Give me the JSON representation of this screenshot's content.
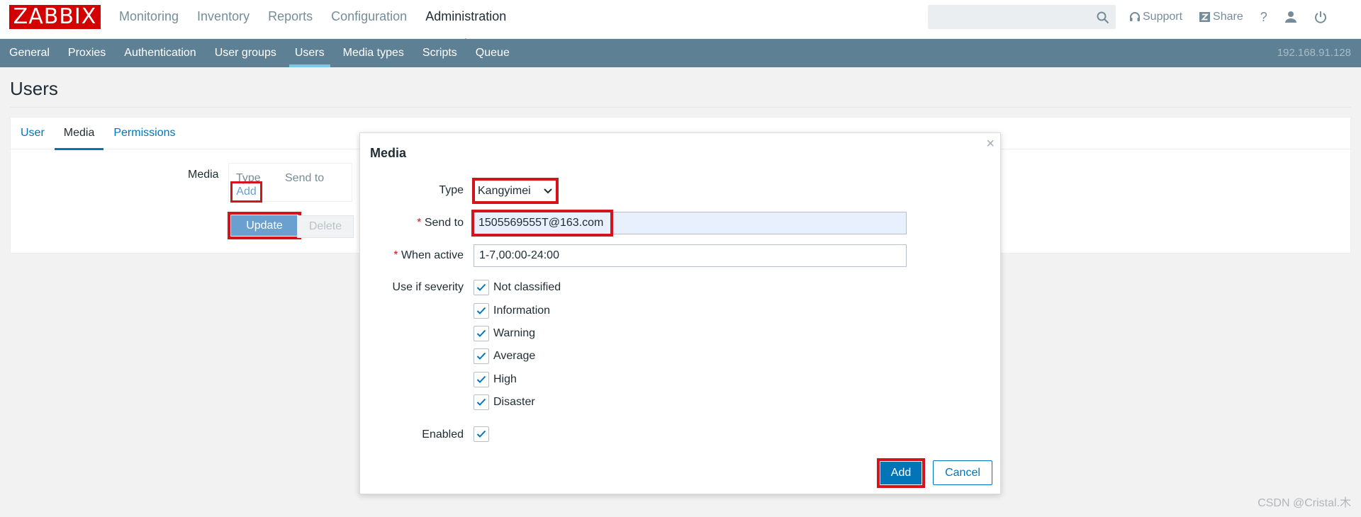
{
  "header": {
    "logo": "ZABBIX",
    "menu": [
      "Monitoring",
      "Inventory",
      "Reports",
      "Configuration",
      "Administration"
    ],
    "active_menu": "Administration",
    "search": {
      "value": "",
      "placeholder": ""
    },
    "support_label": "Support",
    "share_label": "Share",
    "help_label": "?"
  },
  "submenu": {
    "items": [
      "General",
      "Proxies",
      "Authentication",
      "User groups",
      "Users",
      "Media types",
      "Scripts",
      "Queue"
    ],
    "active": "Users",
    "server": "192.168.91.128"
  },
  "page": {
    "title": "Users",
    "tabs": [
      "User",
      "Media",
      "Permissions"
    ],
    "active_tab": "Media",
    "media_label": "Media",
    "media_table": {
      "col_type": "Type",
      "col_sendto": "Send to"
    },
    "add_link": "Add",
    "update_button": "Update",
    "delete_button": "Delete"
  },
  "modal": {
    "title": "Media",
    "close": "×",
    "type_label": "Type",
    "type_value": "Kangyimei",
    "sendto_label": "Send to",
    "sendto_value": "1505569555T@163.com",
    "when_active_label": "When active",
    "when_active_value": "1-7,00:00-24:00",
    "severity_label": "Use if severity",
    "severities": [
      "Not classified",
      "Information",
      "Warning",
      "Average",
      "High",
      "Disaster"
    ],
    "enabled_label": "Enabled",
    "add_button": "Add",
    "cancel_button": "Cancel"
  },
  "watermark": "CSDN @Cristal.木",
  "colors": {
    "brand_red": "#d40000",
    "submenu_bg": "#5e8094",
    "primary_blue": "#0275b8",
    "highlight_red": "#d5131d"
  }
}
